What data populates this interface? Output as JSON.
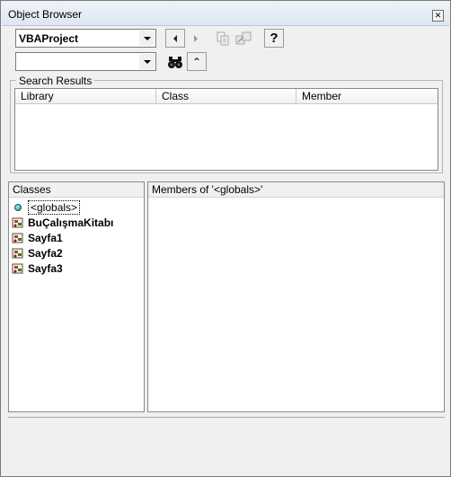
{
  "window": {
    "title": "Object Browser",
    "close_glyph": "✕"
  },
  "toolbar": {
    "library_combo": {
      "value": "VBAProject"
    },
    "search_combo": {
      "value": ""
    },
    "icons": [
      "arrow-left-icon",
      "arrow-right-icon",
      "copy-icon",
      "view-definition-icon",
      "help-icon",
      "binoculars-icon",
      "collapse-icon"
    ],
    "help_glyph": "?",
    "collapse_glyph": "⌃"
  },
  "search_results": {
    "title": "Search Results",
    "columns": [
      "Library",
      "Class",
      "Member"
    ],
    "rows": []
  },
  "classes": {
    "header": "Classes",
    "items": [
      {
        "label": "<globals>",
        "icon": "globe-icon",
        "selected": true
      },
      {
        "label": "BuÇalışmaKitabı",
        "icon": "workbook-module-icon"
      },
      {
        "label": "Sayfa1",
        "icon": "worksheet-module-icon"
      },
      {
        "label": "Sayfa2",
        "icon": "worksheet-module-icon"
      },
      {
        "label": "Sayfa3",
        "icon": "worksheet-module-icon"
      }
    ]
  },
  "members": {
    "header": "Members of '<globals>'",
    "items": []
  },
  "details": {
    "text": ""
  }
}
